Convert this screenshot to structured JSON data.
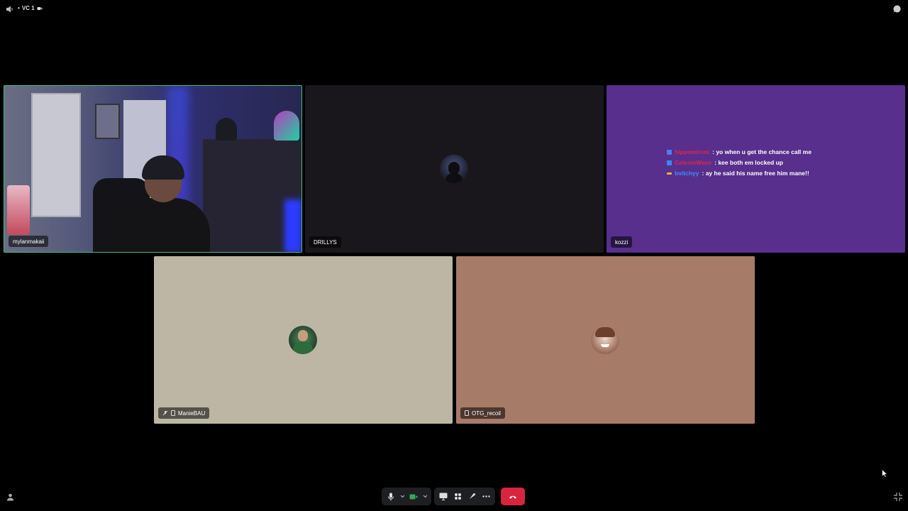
{
  "topbar": {
    "channel_name": "VC 1",
    "dot": "•",
    "speaker_icon": "speaker-icon",
    "chat_icon": "chat-bubble-icon"
  },
  "participants": [
    {
      "name": "mylanmakaii",
      "type": "camera",
      "active_speaker": true
    },
    {
      "name": "DRILLYS",
      "type": "avatar",
      "bg": "#19171c"
    },
    {
      "name": "kozzi",
      "type": "screenshare",
      "bg": "#582f8c"
    },
    {
      "name": "ManieBAU",
      "type": "avatar",
      "bg": "#bdb6a4",
      "muted": true,
      "mobile": true
    },
    {
      "name": "OTG_recoil",
      "type": "avatar",
      "bg": "#a67b68",
      "mobile": true
    }
  ],
  "stream_chat": [
    {
      "user": "hippomirrax",
      "user_color": "#e0264a",
      "badge_color": "#4f7bff",
      "message": ": yo when u get the chance call me"
    },
    {
      "user": "CelesteWave",
      "user_color": "#e0264a",
      "badge_color": "#2f8cff",
      "message": ": kee both em locked up"
    },
    {
      "user": "bvitchyy",
      "user_color": "#3c8cff",
      "badge_color": "#e0b83c",
      "message": ": ay he said his name free him mane!!"
    }
  ],
  "controls": {
    "mic_icon": "microphone-icon",
    "camera_icon": "camera-icon",
    "screenshare_icon": "screen-share-icon",
    "activities_icon": "activities-icon",
    "soundboard_icon": "soundboard-icon",
    "more_icon": "more-icon",
    "leave_icon": "hang-up-icon",
    "accent_leave": "#d8243f",
    "accent_camera": "#3ba55c"
  }
}
